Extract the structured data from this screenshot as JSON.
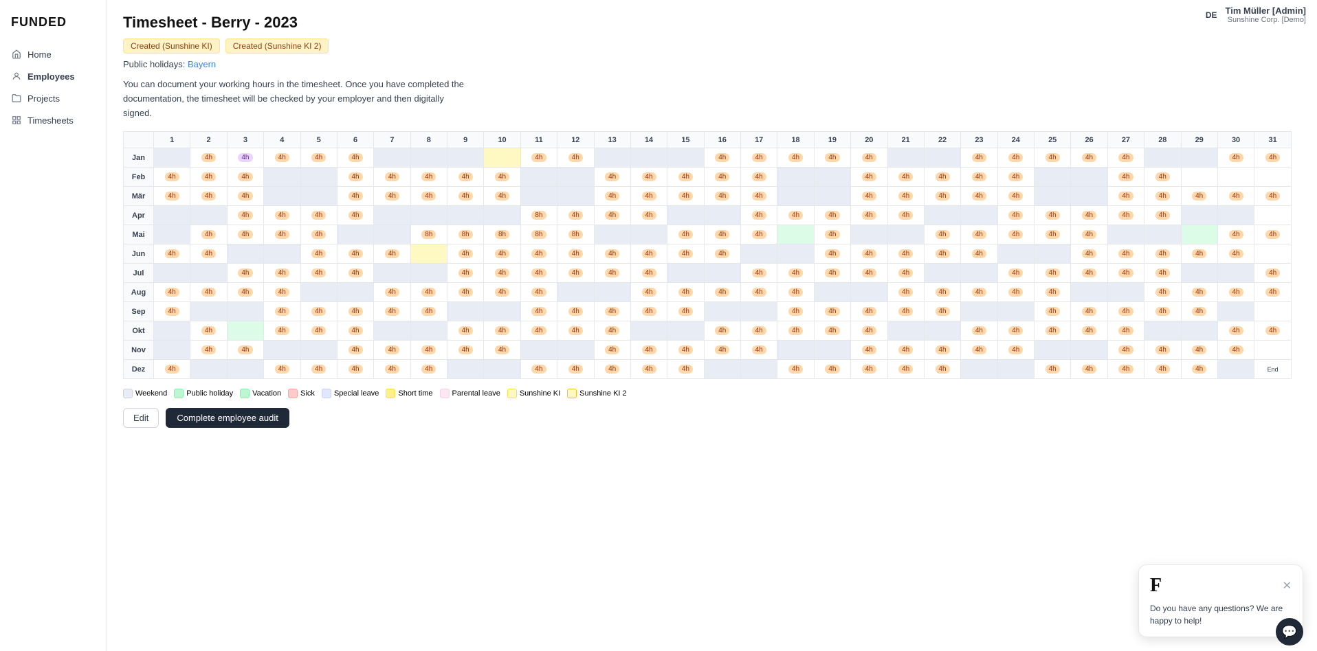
{
  "app": {
    "logo": "FUNDED",
    "lang": "DE",
    "user": {
      "name": "Tim Müller [Admin]",
      "company": "Sunshine Corp. [Demo]"
    }
  },
  "sidebar": {
    "items": [
      {
        "label": "Home",
        "icon": "home"
      },
      {
        "label": "Employees",
        "icon": "user"
      },
      {
        "label": "Projects",
        "icon": "folder"
      },
      {
        "label": "Timesheets",
        "icon": "grid",
        "active": true
      }
    ]
  },
  "page": {
    "title": "Timesheet - Berry - 2023",
    "badges": [
      {
        "label": "Created (Sunshine KI)",
        "style": "sunshine"
      },
      {
        "label": "Created (Sunshine KI 2)",
        "style": "sunshine2"
      }
    ],
    "holidays_label": "Public holidays:",
    "holidays_link": "Bayern",
    "description": "You can document your working hours in the timesheet. Once you have completed the documentation, the timesheet will be checked by your employer and then digitally signed."
  },
  "legend": [
    {
      "label": "Weekend",
      "style": "weekend"
    },
    {
      "label": "Public holiday",
      "style": "holiday"
    },
    {
      "label": "Vacation",
      "style": "vacation"
    },
    {
      "label": "Sick",
      "style": "sick"
    },
    {
      "label": "Special leave",
      "style": "special"
    },
    {
      "label": "Short time",
      "style": "short"
    },
    {
      "label": "Parental leave",
      "style": "parental"
    },
    {
      "label": "Sunshine KI",
      "style": "sunshine"
    },
    {
      "label": "Sunshine KI 2",
      "style": "sunshine2"
    }
  ],
  "actions": {
    "edit": "Edit",
    "audit": "Complete employee audit"
  },
  "chat": {
    "logo": "F",
    "text": "Do you have any questions? We are happy to help!"
  },
  "calendar": {
    "days": [
      1,
      2,
      3,
      4,
      5,
      6,
      7,
      8,
      9,
      10,
      11,
      12,
      13,
      14,
      15,
      16,
      17,
      18,
      19,
      20,
      21,
      22,
      23,
      24,
      25,
      26,
      27,
      28,
      29,
      30,
      31
    ],
    "months": [
      "Jan",
      "Feb",
      "Mär",
      "Apr",
      "Mai",
      "Jun",
      "Jul",
      "Aug",
      "Sep",
      "Okt",
      "Nov",
      "Dez"
    ]
  }
}
